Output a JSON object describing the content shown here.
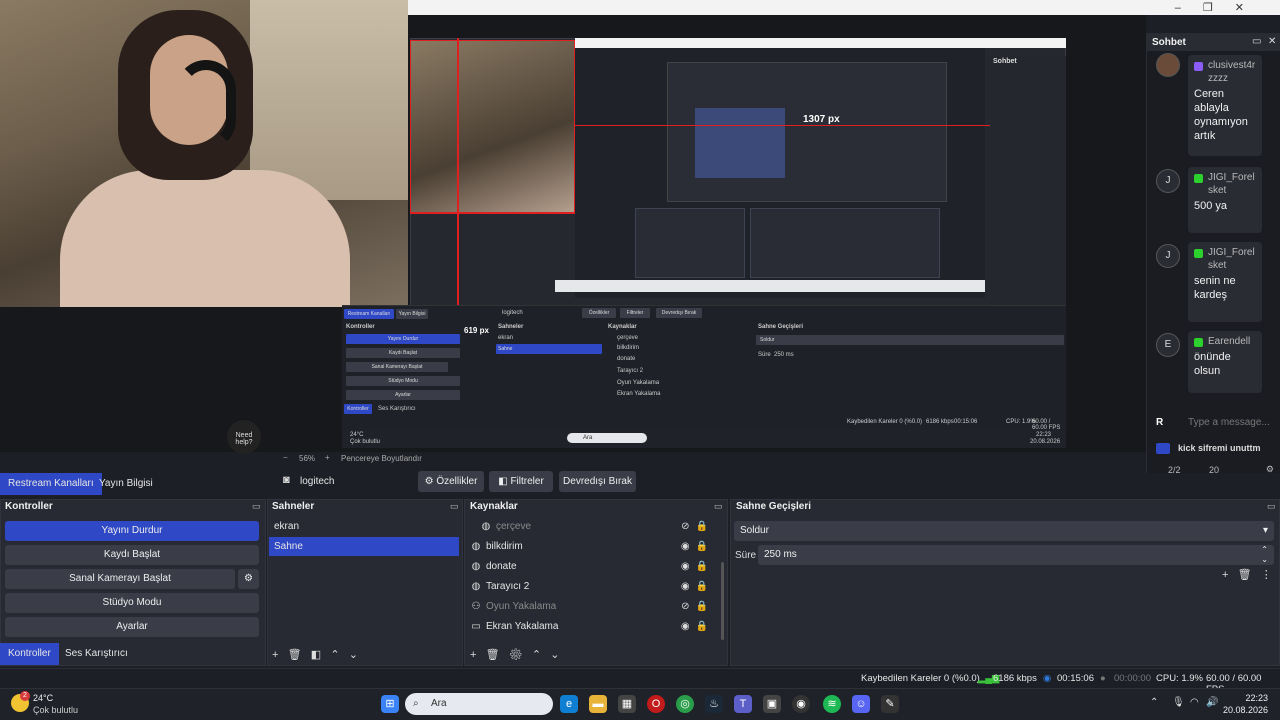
{
  "window": {
    "controls": [
      "–",
      "❐",
      "✕"
    ]
  },
  "preview": {
    "px_label": "1307 px",
    "px_label2": "619 px",
    "need_help": "Need help?",
    "zoom": "56%",
    "zoom_minus": "−",
    "zoom_plus": "+",
    "fit_label": "Pencereye Boyutlandır",
    "nested_chat_title": "Sohbet"
  },
  "chat": {
    "title": "Sohbet",
    "messages": [
      {
        "avatar": "",
        "platform": "twitch",
        "user": "clusivest4rzzzz",
        "text": "Ceren ablayla oynamıyon artık"
      },
      {
        "avatar": "J",
        "platform": "kick",
        "user": "JIGI_Forelsket",
        "text": "500 ya"
      },
      {
        "avatar": "J",
        "platform": "kick",
        "user": "JIGI_Forelsket",
        "text": "senin ne kardeş"
      },
      {
        "avatar": "E",
        "platform": "kick",
        "user": "Earendell",
        "text": "önünde olsun"
      }
    ],
    "input_prefix": "R",
    "input_placeholder": "Type a message...",
    "pinned": "kick sifremi unuttm",
    "stats_pages": "2/2",
    "stats_viewers": "20"
  },
  "tabs": {
    "left": [
      "Restream Kanalları",
      "Yayın Bilgisi"
    ],
    "active": "Restream Kanalları"
  },
  "source_bar": {
    "source_name": "logitech",
    "properties": "Özellikler",
    "filters": "Filtreler",
    "deactivate": "Devredışı Bırak"
  },
  "controls_panel": {
    "title": "Kontroller",
    "buttons": [
      "Yayını Durdur",
      "Kaydı Başlat",
      "Sanal Kamerayı Başlat",
      "Stüdyo Modu",
      "Ayarlar"
    ],
    "footer_tabs": [
      "Kontroller",
      "Ses Karıştırıcı"
    ]
  },
  "scenes_panel": {
    "title": "Sahneler",
    "items": [
      "ekran",
      "Sahne"
    ],
    "active": "Sahne"
  },
  "sources_panel": {
    "title": "Kaynaklar",
    "items": [
      {
        "name": "çerçeve",
        "visible": false
      },
      {
        "name": "bilkdirim",
        "visible": true
      },
      {
        "name": "donate",
        "visible": true
      },
      {
        "name": "Tarayıcı 2",
        "visible": true
      },
      {
        "name": "Oyun Yakalama",
        "visible": false
      },
      {
        "name": "Ekran Yakalama",
        "visible": true
      }
    ]
  },
  "transitions_panel": {
    "title": "Sahne Geçişleri",
    "transition": "Soldur",
    "duration_label": "Süre",
    "duration": "250 ms"
  },
  "status": {
    "dropped": "Kaybedilen Kareler 0 (%0.0)",
    "bitrate": "6186 kbps",
    "stream_time": "00:15:06",
    "rec_time": "00:00:00",
    "cpu": "CPU: 1.9%",
    "fps": "60.00 / 60.00 FPS"
  },
  "taskbar": {
    "weather_temp": "24°C",
    "weather_cond": "Çok bulutlu",
    "weather_badge": "2",
    "search_placeholder": "Ara",
    "time": "22:23",
    "date": "20.08.2026"
  },
  "colors": {
    "accent": "#2f48c5",
    "kick": "#2dd12d",
    "twitch": "#8b5cf6",
    "recording_red": "#e02020"
  }
}
